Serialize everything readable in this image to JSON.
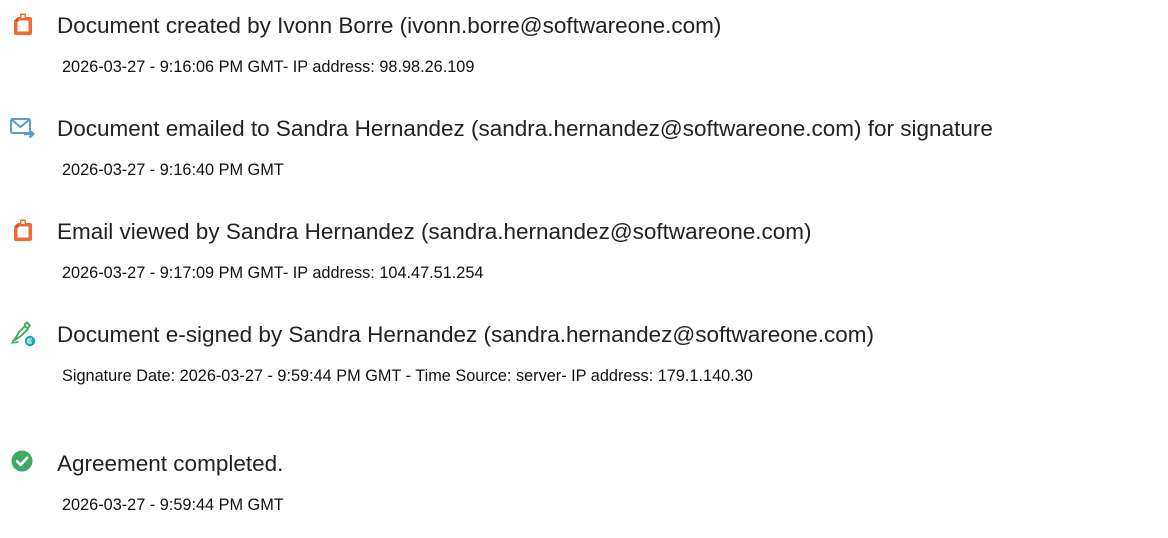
{
  "events": [
    {
      "icon": "document-created-icon",
      "title": "Document created by Ivonn Borre (ivonn.borre@softwareone.com)",
      "meta": "2026-03-27 - 9:16:06 PM GMT- IP address: 98.98.26.109"
    },
    {
      "icon": "email-sent-icon",
      "title": "Document emailed to Sandra Hernandez (sandra.hernandez@softwareone.com) for signature",
      "meta": "2026-03-27 - 9:16:40 PM GMT"
    },
    {
      "icon": "document-viewed-icon",
      "title": "Email viewed by Sandra Hernandez (sandra.hernandez@softwareone.com)",
      "meta": "2026-03-27 - 9:17:09 PM GMT- IP address: 104.47.51.254"
    },
    {
      "icon": "e-sign-pen-icon",
      "title": "Document e-signed by Sandra Hernandez (sandra.hernandez@softwareone.com)",
      "meta": "Signature Date: 2026-03-27 - 9:59:44 PM GMT - Time Source: server- IP address: 179.1.140.30"
    },
    {
      "icon": "checkmark-circle-icon",
      "title": "Agreement completed.",
      "meta": "2026-03-27 - 9:59:44 PM GMT"
    }
  ],
  "colors": {
    "orange": "#F06A34",
    "blue": "#5B9BD5",
    "green": "#3DAA64",
    "teal": "#1FA7B0",
    "text": "#222222"
  }
}
